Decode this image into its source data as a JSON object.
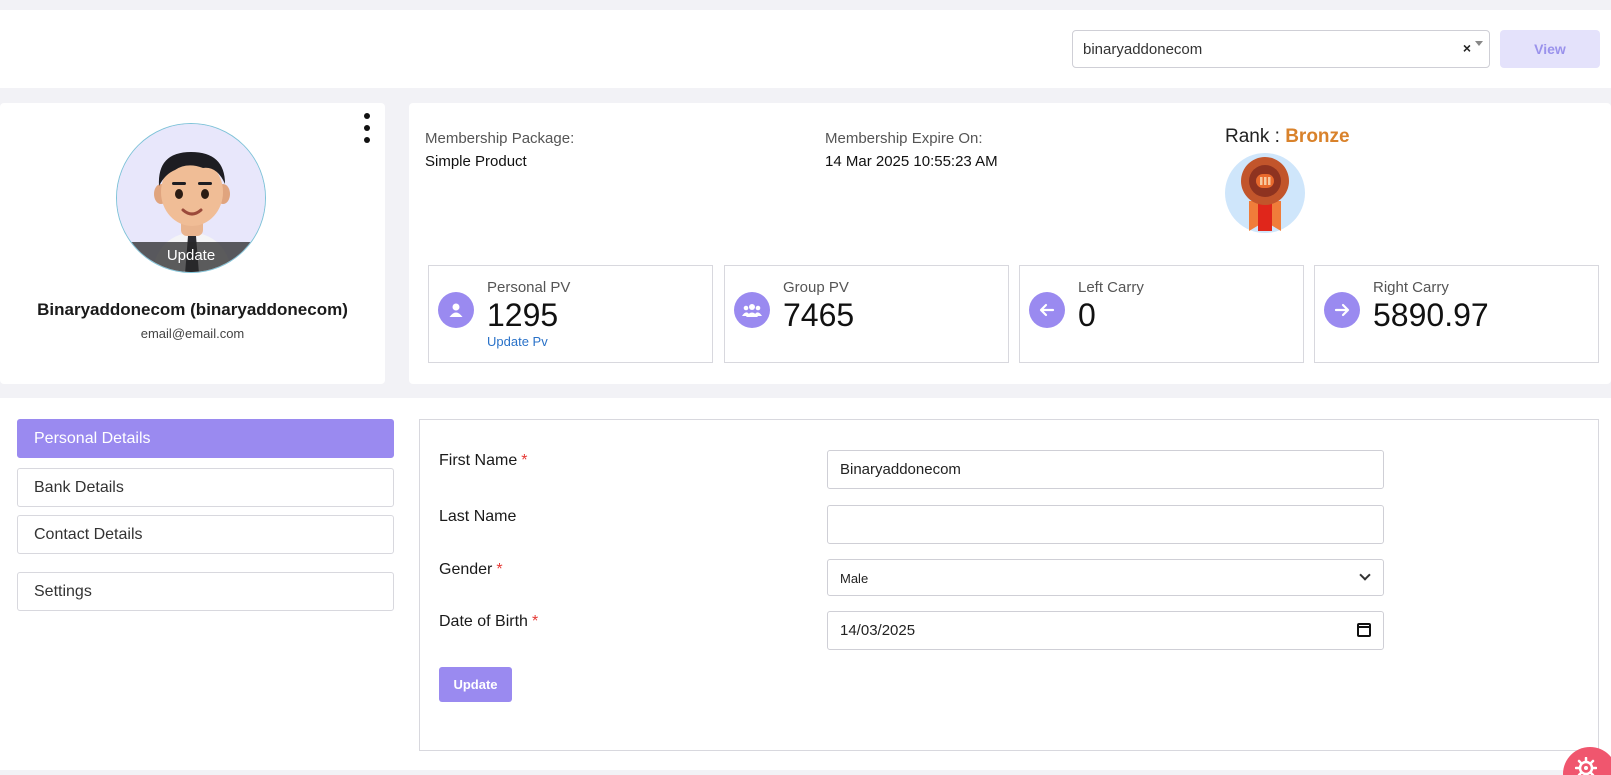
{
  "header": {
    "selected_user": "binaryaddonecom",
    "clear_glyph": "×",
    "view_label": "View"
  },
  "profile": {
    "name": "Binaryaddonecom (binaryaddonecom)",
    "email": "email@email.com",
    "avatar_update_label": "Update"
  },
  "membership": {
    "package_label": "Membership Package:",
    "package_value": "Simple Product",
    "expire_label": "Membership Expire On:",
    "expire_value": "14 Mar 2025 10:55:23 AM",
    "rank_label": "Rank :",
    "rank_value": "Bronze",
    "rank_color": "#d9822b"
  },
  "stats": [
    {
      "title": "Personal PV",
      "value": "1295",
      "link": "Update Pv",
      "icon": "user-icon"
    },
    {
      "title": "Group PV",
      "value": "7465",
      "icon": "users-icon"
    },
    {
      "title": "Left Carry",
      "value": "0",
      "icon": "arrow-left-icon"
    },
    {
      "title": "Right Carry",
      "value": "5890.97",
      "icon": "arrow-right-icon"
    }
  ],
  "sidebar": {
    "items": [
      {
        "label": "Personal Details",
        "active": true
      },
      {
        "label": "Bank Details"
      },
      {
        "label": "Contact Details"
      },
      {
        "label": "Settings"
      }
    ]
  },
  "form": {
    "first_name_label": "First Name",
    "first_name_value": "Binaryaddonecom",
    "last_name_label": "Last Name",
    "last_name_value": "",
    "gender_label": "Gender",
    "gender_value": "Male",
    "dob_label": "Date of Birth",
    "dob_value": "14/03/2025",
    "required_mark": "*",
    "update_label": "Update"
  },
  "colors": {
    "accent": "#9a8af0",
    "link": "#2a72c8",
    "required": "#e53935",
    "fab": "#f0566e"
  }
}
